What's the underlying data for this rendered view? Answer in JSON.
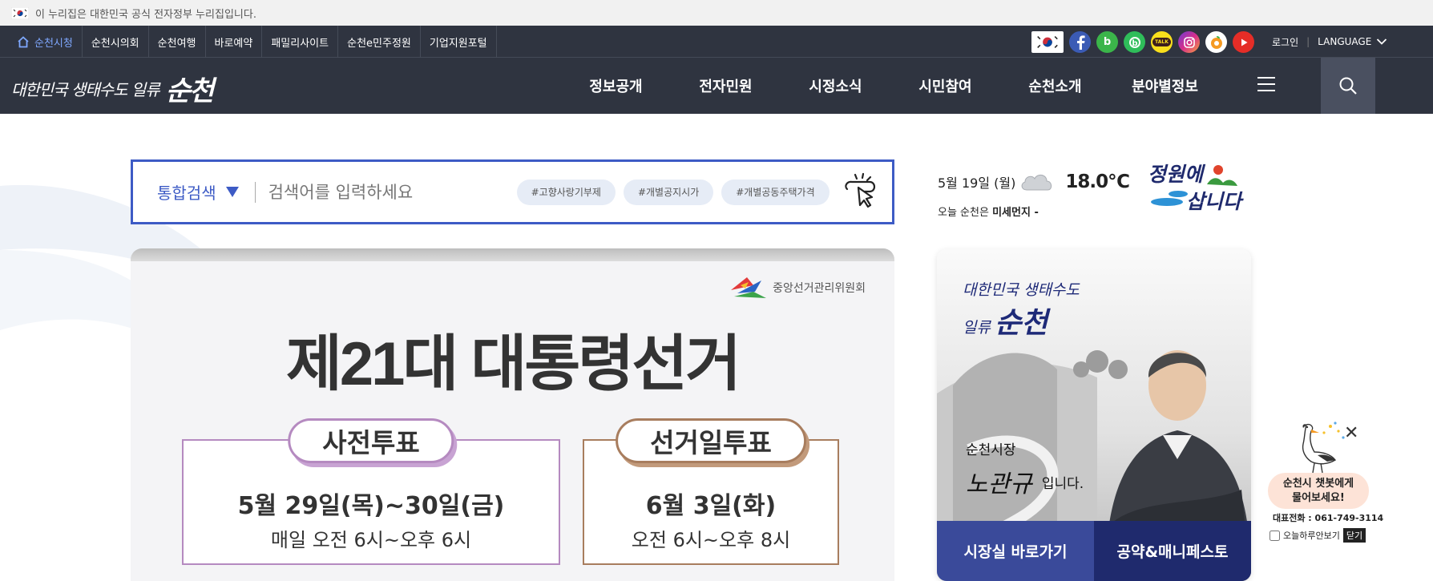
{
  "notice": {
    "text": "이 누리집은 대한민국 공식 전자정부 누리집입니다."
  },
  "util": {
    "sites": [
      "순천시청",
      "순천시의회",
      "순천여행",
      "바로예약",
      "패밀리사이트",
      "순천e민주정원",
      "기업지원포털"
    ],
    "login": "로그인",
    "language": "LANGUAGE"
  },
  "sns": {
    "blog_letter": "b",
    "band_letter": "b",
    "kakao": "TALK"
  },
  "logo": {
    "small": "대한민국 생태수도 일류",
    "big": "순천"
  },
  "menu": [
    "정보공개",
    "전자민원",
    "시정소식",
    "시민참여",
    "순천소개",
    "분야별정보"
  ],
  "search": {
    "category": "통합검색",
    "placeholder": "검색어를 입력하세요",
    "tags": [
      "#고향사랑기부제",
      "#개별공지시가",
      "#개별공동주택가격"
    ]
  },
  "banner": {
    "org": "중앙선거관리위원회",
    "title": "제21대 대통령선거",
    "early": {
      "label": "사전투표",
      "date": "5월 29일(목)~30일(금)",
      "time": "매일 오전 6시~오후 6시"
    },
    "day": {
      "label": "선거일투표",
      "date": "6월 3일(화)",
      "time": "오전 6시~오후 8시"
    }
  },
  "weather": {
    "date": "5월 19일 (월)",
    "temp": "18.0℃",
    "dust_prefix": "오늘 순천은",
    "dust_label": "미세먼지 -"
  },
  "jeongwon": {
    "line1": "정원에",
    "line2": "삽니다"
  },
  "mayor": {
    "slogan1": "대한민국 생태수도",
    "slogan2": "일류",
    "slogan3": "순천",
    "caption": "순천시장",
    "signature": "노관규",
    "suffix": "입니다.",
    "btn_office": "시장실 바로가기",
    "btn_pledge": "공약&매니페스토"
  },
  "chatbot": {
    "line1": "순천시 챗봇에게",
    "line2": "물어보세요!",
    "phone": "대표전화 : 061-749-3114",
    "today": "오늘하루안보기",
    "close": "닫기"
  },
  "colors": {
    "accent": "#3d5bc5",
    "nav_bg": "#2f3440",
    "navy": "#1f2a6d"
  }
}
